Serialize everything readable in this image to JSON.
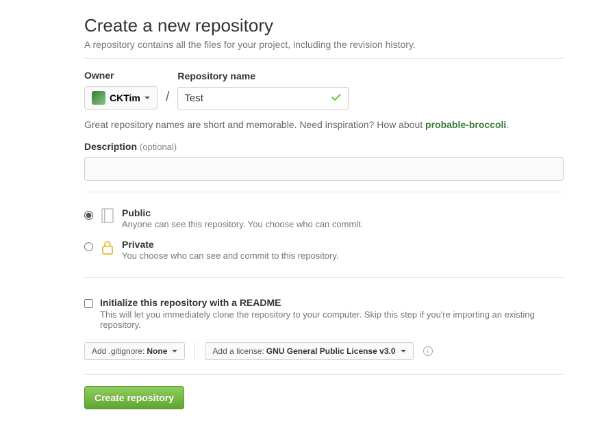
{
  "header": {
    "title": "Create a new repository",
    "subtitle": "A repository contains all the files for your project, including the revision history."
  },
  "owner": {
    "label": "Owner",
    "name": "CKTim"
  },
  "repo": {
    "label": "Repository name",
    "value": "Test"
  },
  "hint": {
    "prefix": "Great repository names are short and memorable. Need inspiration? How about ",
    "suggestion": "probable-broccoli",
    "suffix": "."
  },
  "description": {
    "label": "Description",
    "optional": "(optional)",
    "value": ""
  },
  "visibility": {
    "public": {
      "title": "Public",
      "desc": "Anyone can see this repository. You choose who can commit."
    },
    "private": {
      "title": "Private",
      "desc": "You choose who can see and commit to this repository."
    }
  },
  "readme": {
    "title": "Initialize this repository with a README",
    "desc": "This will let you immediately clone the repository to your computer. Skip this step if you're importing an existing repository."
  },
  "gitignore": {
    "prefix": "Add .gitignore: ",
    "value": "None"
  },
  "license": {
    "prefix": "Add a license: ",
    "value": "GNU General Public License v3.0"
  },
  "submit": {
    "label": "Create repository"
  }
}
